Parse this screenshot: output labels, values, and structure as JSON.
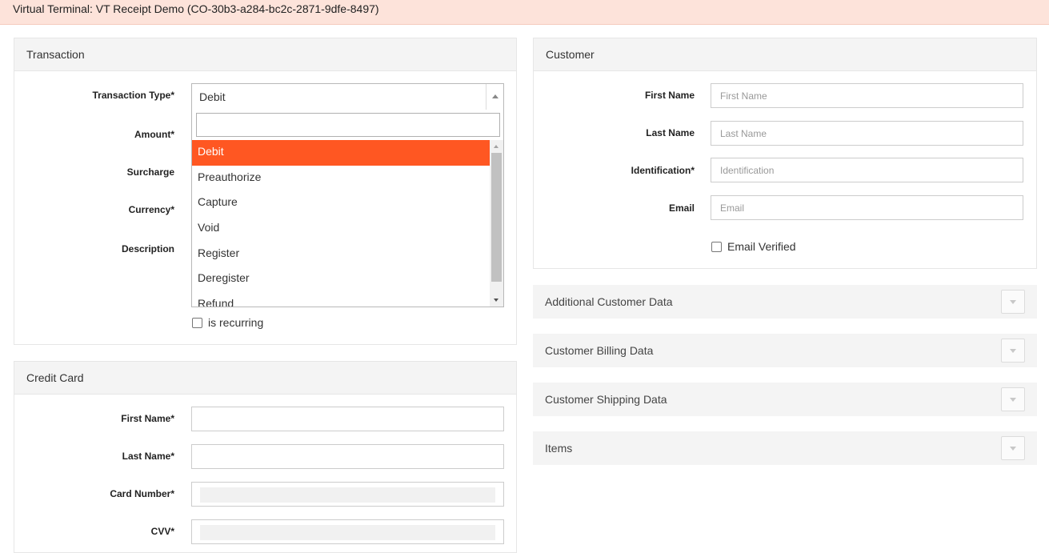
{
  "window": {
    "title": "Virtual Terminal: VT Receipt Demo (CO-30b3-a284-bc2c-2871-9dfe-8497)"
  },
  "transaction": {
    "title": "Transaction",
    "labels": {
      "transaction_type": "Transaction Type*",
      "amount": "Amount*",
      "surcharge": "Surcharge",
      "currency": "Currency*",
      "description": "Description"
    },
    "transaction_type_value": "Debit",
    "dropdown_options": [
      "Debit",
      "Preauthorize",
      "Capture",
      "Void",
      "Register",
      "Deregister",
      "Refund"
    ],
    "selected_option": "Debit",
    "recurring_label": "is recurring"
  },
  "credit_card": {
    "title": "Credit Card",
    "labels": {
      "first_name": "First Name*",
      "last_name": "Last Name*",
      "card_number": "Card Number*",
      "cvv": "CVV*"
    }
  },
  "customer": {
    "title": "Customer",
    "labels": {
      "first_name": "First Name",
      "last_name": "Last Name",
      "identification": "Identification*",
      "email": "Email"
    },
    "placeholders": {
      "first_name": "First Name",
      "last_name": "Last Name",
      "identification": "Identification",
      "email": "Email"
    },
    "email_verified_label": "Email Verified"
  },
  "sections": [
    {
      "title": "Additional Customer Data"
    },
    {
      "title": "Customer Billing Data"
    },
    {
      "title": "Customer Shipping Data"
    },
    {
      "title": "Items"
    }
  ],
  "colors": {
    "accent": "#ff5722",
    "topbar_bg": "#fde3da",
    "panel_head_bg": "#f4f4f4"
  }
}
